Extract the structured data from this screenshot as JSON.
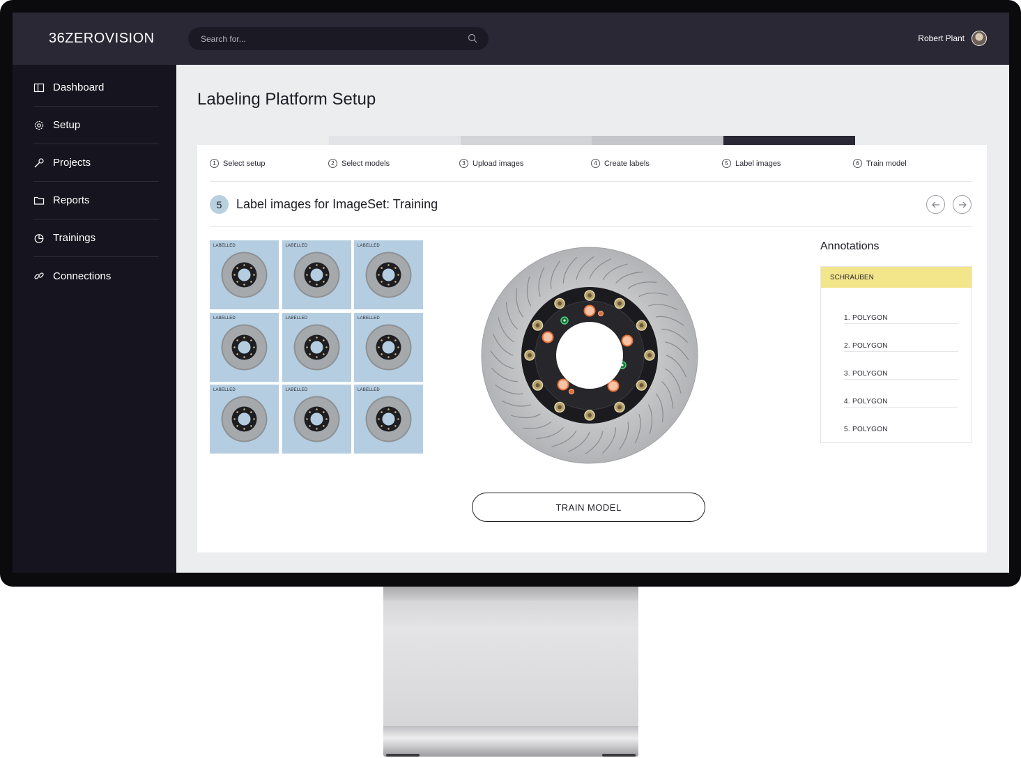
{
  "header": {
    "logo": "36ZEROVISION",
    "search_placeholder": "Search for...",
    "user_name": "Robert Plant"
  },
  "sidebar": {
    "items": [
      {
        "label": "Dashboard",
        "icon": "layout-icon"
      },
      {
        "label": "Setup",
        "icon": "gear-icon"
      },
      {
        "label": "Projects",
        "icon": "wrench-icon"
      },
      {
        "label": "Reports",
        "icon": "folder-icon"
      },
      {
        "label": "Trainings",
        "icon": "pie-chart-icon"
      },
      {
        "label": "Connections",
        "icon": "link-icon"
      }
    ]
  },
  "main": {
    "title": "Labeling Platform Setup",
    "progress_colors": [
      "#ecedef",
      "#e3e4e7",
      "#d3d4d8",
      "#c4c5ca",
      "#2a2835",
      "#ecedef"
    ],
    "steps": [
      {
        "num": "1",
        "label": "Select setup"
      },
      {
        "num": "2",
        "label": "Select models"
      },
      {
        "num": "3",
        "label": "Upload images"
      },
      {
        "num": "4",
        "label": "Create labels"
      },
      {
        "num": "5",
        "label": "Label images"
      },
      {
        "num": "6",
        "label": "Train model"
      }
    ],
    "section": {
      "num": "5",
      "title": "Label images for ImageSet: Training"
    },
    "thumbnails": [
      "LABELLED",
      "LABELLED",
      "LABELLED",
      "LABELLED",
      "LABELLED",
      "LABELLED",
      "LABELLED",
      "LABELLED",
      "LABELLED"
    ],
    "train_button": "TRAIN MODEL",
    "annotations": {
      "title": "Annotations",
      "label": "SCHRAUBEN",
      "label_color": "#f3e58a",
      "items": [
        "1. POLYGON",
        "2. POLYGON",
        "3. POLYGON",
        "4. POLYGON",
        "5. POLYGON"
      ]
    }
  }
}
